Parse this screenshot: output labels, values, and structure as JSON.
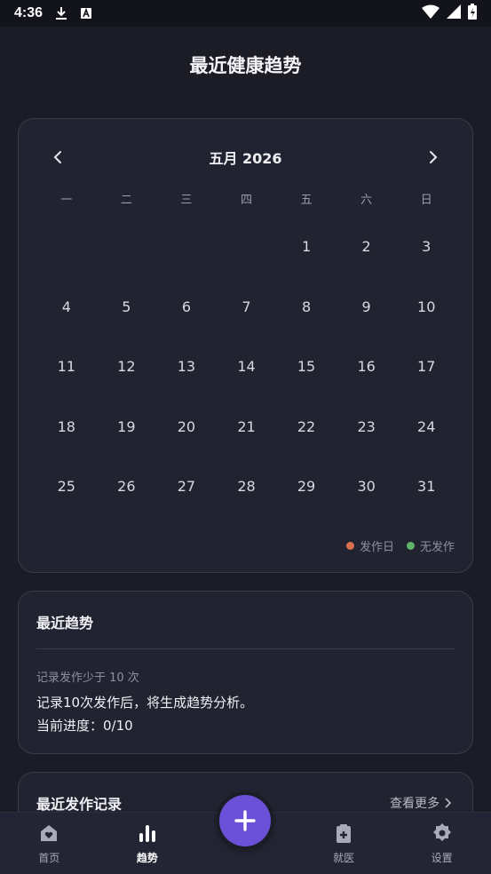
{
  "status_bar": {
    "time": "4:36",
    "icons": [
      "download-icon",
      "a-box-icon",
      "wifi-icon",
      "signal-icon",
      "battery-charging-icon"
    ]
  },
  "page": {
    "title": "最近健康趋势"
  },
  "calendar": {
    "month_label": "五月 2026",
    "weekdays": [
      "一",
      "二",
      "三",
      "四",
      "五",
      "六",
      "日"
    ],
    "leading_blanks": 4,
    "days": [
      "1",
      "2",
      "3",
      "4",
      "5",
      "6",
      "7",
      "8",
      "9",
      "10",
      "11",
      "12",
      "13",
      "14",
      "15",
      "16",
      "17",
      "18",
      "19",
      "20",
      "21",
      "22",
      "23",
      "24",
      "25",
      "26",
      "27",
      "28",
      "29",
      "30",
      "31"
    ],
    "legend": [
      {
        "label": "发作日",
        "color": "#d9704e"
      },
      {
        "label": "无发作",
        "color": "#5fb56a"
      }
    ]
  },
  "trend": {
    "title": "最近趋势",
    "subtitle": "记录发作少于 10 次",
    "line1": "记录10次发作后，将生成趋势分析。",
    "line2": "当前进度：0/10"
  },
  "records": {
    "title": "最近发作记录",
    "more_label": "查看更多"
  },
  "bottom_nav": {
    "items": [
      {
        "label": "首页",
        "icon": "home-heart-icon",
        "active": false
      },
      {
        "label": "趋势",
        "icon": "bar-chart-icon",
        "active": true
      },
      {
        "label": "就医",
        "icon": "clipboard-medical-icon",
        "active": false
      },
      {
        "label": "设置",
        "icon": "gear-icon",
        "active": false
      }
    ],
    "fab_icon": "plus-icon"
  },
  "colors": {
    "background": "#1b1c26",
    "card": "#212330",
    "accent": "#6a4fd8",
    "seizure_day": "#d9704e",
    "no_seizure": "#5fb56a"
  }
}
